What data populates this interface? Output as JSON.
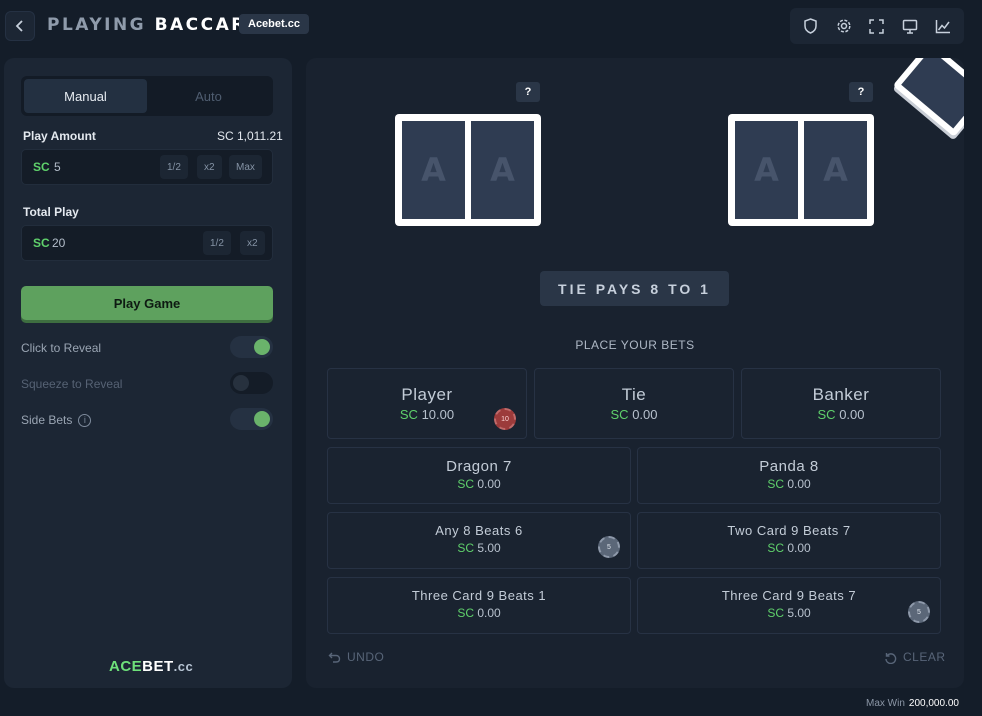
{
  "header": {
    "title_prefix": "PLAYING",
    "title_main": "BACCARAT",
    "brand_badge": "Acebet.cc",
    "toolbar_icons": [
      "shield-icon",
      "gear-icon",
      "fullscreen-icon",
      "monitor-icon",
      "chart-icon"
    ]
  },
  "left_panel": {
    "tabs": [
      {
        "label": "Manual",
        "active": true
      },
      {
        "label": "Auto",
        "active": false
      }
    ],
    "play_amount": {
      "label": "Play Amount",
      "balance": "SC 1,011.21",
      "currency": "SC",
      "value": "5",
      "buttons": [
        "1/2",
        "x2",
        "Max"
      ]
    },
    "total_play": {
      "label": "Total Play",
      "currency": "SC",
      "value": "20",
      "buttons": [
        "1/2",
        "x2"
      ]
    },
    "play_button": "Play Game",
    "options": [
      {
        "label": "Click to Reveal",
        "on": true
      },
      {
        "label": "Squeeze to Reveal",
        "on": false
      },
      {
        "label": "Side Bets",
        "on": true
      }
    ],
    "logo": {
      "part1": "ACE",
      "part2": "BET",
      "part3": ".cc"
    }
  },
  "game": {
    "player_cards": [
      "A",
      "A"
    ],
    "banker_cards": [
      "A",
      "A"
    ],
    "help_badge": "?",
    "tie_banner": "TIE PAYS 8 TO 1",
    "place_bets": "PLACE YOUR BETS",
    "main_bets": [
      {
        "name": "Player",
        "currency": "SC",
        "amount": "10.00",
        "chip": "10"
      },
      {
        "name": "Tie",
        "currency": "SC",
        "amount": "0.00"
      },
      {
        "name": "Banker",
        "currency": "SC",
        "amount": "0.00"
      }
    ],
    "side_bets": [
      {
        "name": "Dragon 7",
        "currency": "SC",
        "amount": "0.00"
      },
      {
        "name": "Panda 8",
        "currency": "SC",
        "amount": "0.00"
      },
      {
        "name": "Any 8 Beats 6",
        "currency": "SC",
        "amount": "5.00",
        "chip": "5"
      },
      {
        "name": "Two Card 9 Beats 7",
        "currency": "SC",
        "amount": "0.00"
      },
      {
        "name": "Three Card 9 Beats 1",
        "currency": "SC",
        "amount": "0.00"
      },
      {
        "name": "Three Card 9 Beats 7",
        "currency": "SC",
        "amount": "5.00",
        "chip": "5"
      }
    ],
    "undo_label": "UNDO",
    "clear_label": "CLEAR"
  },
  "footer": {
    "max_win_label": "Max Win",
    "max_win_value": "200,000.00"
  },
  "colors": {
    "background": "#141d29",
    "panel": "#1c2634",
    "accent_green": "#5ea15e",
    "currency_green": "#5fd06b"
  }
}
